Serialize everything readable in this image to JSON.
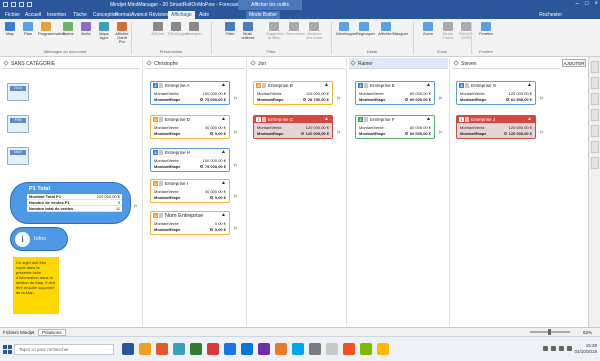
{
  "titlebar": {
    "title": "Mindjet MindManager - 20 SmartRollOnMoPow - Forecast",
    "context": "Afficher les outils"
  },
  "menu": {
    "tabs": [
      "Fichier",
      "Accueil",
      "Insertion",
      "Tâche",
      "Conception",
      "Format",
      "Avancé",
      "Révision",
      "Affichage",
      "Aide"
    ],
    "active_index": 8,
    "context_tab": "Mode Boitier",
    "user": "Rochester"
  },
  "ribbon": {
    "buttons": [
      {
        "label": "Map",
        "color": "#3a7bd5"
      },
      {
        "label": "Plan",
        "color": "#5aa0e8"
      },
      {
        "label": "Programmation",
        "color": "#e8a23a"
      },
      {
        "label": "Scène",
        "color": "#6fb36b"
      },
      {
        "label": "Boîte",
        "color": "#8c6bc4"
      },
      {
        "label": "Maps Agro",
        "color": "#3aa0b8"
      },
      {
        "label": "Afficher Gantt Pro",
        "color": "#d46f3a"
      },
      {
        "label": "Afficher",
        "color": "#888888"
      },
      {
        "label": "Développer",
        "color": "#888888"
      },
      {
        "label": "Masquer",
        "color": "#888888"
      },
      {
        "label": "Filtre",
        "color": "#4a7ac0"
      },
      {
        "label": "Multi-critères",
        "color": "#4a7ac0"
      },
      {
        "label": "Supprimer le filtre",
        "color": "#aaaaaa"
      },
      {
        "label": "Renommer",
        "color": "#aaaaaa"
      },
      {
        "label": "Gestion des vues",
        "color": "#aaaaaa"
      },
      {
        "label": "Développer",
        "color": "#5aa0e8"
      },
      {
        "label": "Regrouper",
        "color": "#5aa0e8"
      },
      {
        "label": "Afficher/Masquer",
        "color": "#5aa0e8"
      },
      {
        "label": "Zoom",
        "color": "#5aa0e8"
      },
      {
        "label": "Mode Focus",
        "color": "#aaaaaa"
      },
      {
        "label": "Remplir 100%",
        "color": "#aaaaaa"
      },
      {
        "label": "Fenêtre",
        "color": "#5aa0e8"
      }
    ],
    "groups": [
      "Affichages du document",
      "Présentation",
      "Filtre",
      "Détail",
      "Zoom",
      "Fenêtre"
    ]
  },
  "lanes": [
    {
      "label": "SANS CATÉGORIE"
    },
    {
      "label": "Christophe"
    },
    {
      "label": "Jon"
    },
    {
      "label": "Rainer"
    },
    {
      "label": "Steven"
    }
  ],
  "add_button": "AJOUTER",
  "left": {
    "slots": [
      "2016",
      "FEB",
      "MAR"
    ],
    "total": {
      "title": "P1 Total",
      "rows": [
        {
          "k": "Montant Total P1",
          "v": "220 000,00 €"
        },
        {
          "k": "Nombre de ventes P1",
          "v": "3"
        },
        {
          "k": "Nombre total de ventes",
          "v": "11"
        }
      ]
    },
    "infos": "Infos",
    "note": "Ce sujet doit être copié dans la présente bulle d'information dans la section de Map. Il doit être ensuite supprimé de la Map."
  },
  "cards": [
    {
      "lane": 1,
      "n": "2",
      "color": "blue",
      "name": "Entreprise A",
      "mv": "100 000,00 €",
      "me": "75 000,00 €"
    },
    {
      "lane": 1,
      "n": "3",
      "color": "orange",
      "name": "Entreprise D",
      "mv": "40 000,00 €",
      "me": "0,00 €"
    },
    {
      "lane": 1,
      "n": "2",
      "color": "blue",
      "name": "Entreprise H",
      "mv": "100 000,00 €",
      "me": "75 000,00 €"
    },
    {
      "lane": 1,
      "n": "4",
      "color": "orange",
      "name": "Entreprise I",
      "mv": "40 000,00 €",
      "me": "0,00 €"
    },
    {
      "lane": 1,
      "n": "4",
      "color": "orange",
      "name": "Nom Entreprise",
      "mv": "0,00 €",
      "me": "0,00 €",
      "big": true
    },
    {
      "lane": 2,
      "n": "3",
      "color": "orange",
      "name": "Entreprise B",
      "mv": "115 000,00 €",
      "me": "28 750,00 €"
    },
    {
      "lane": 2,
      "n": "1",
      "color": "red",
      "name": "Entreprise C",
      "mv": "120 000,00 €",
      "me": "120 000,00 €"
    },
    {
      "lane": 3,
      "n": "2",
      "color": "blue",
      "name": "Entreprise E",
      "mv": "80 000,00 €",
      "me": "60 000,00 €"
    },
    {
      "lane": 3,
      "n": "2",
      "color": "green",
      "name": "Entreprise F",
      "mv": "80 000,00 €",
      "me": "60 000,00 €"
    },
    {
      "lane": 4,
      "n": "3",
      "color": "blue",
      "name": "Entreprise G",
      "mv": "125 000,00 €",
      "me": "62 500,00 €"
    },
    {
      "lane": 4,
      "n": "1",
      "color": "red",
      "name": "Entreprise J",
      "mv": "120 000,00 €",
      "me": "120 000,00 €"
    }
  ],
  "field_labels": {
    "mv": "MontantVente",
    "me": "MontantEtape"
  },
  "fx": "fx",
  "status": {
    "left": "Fichiers Mindjet",
    "tab": "Polaisons",
    "zoom": "62%"
  },
  "taskbar": {
    "search": "Taper ici pour rechercher",
    "time": "15:38",
    "date": "03/10/2018"
  },
  "taskbar_apps": [
    "#2b579a",
    "#f0a020",
    "#e05a2b",
    "#3aa0b8",
    "#2e7d32",
    "#d63b3b",
    "#1a73e8",
    "#0078d7",
    "#6f2da8",
    "#e87b2b",
    "#00a4ef",
    "#7a7a7a",
    "#c8c8c8",
    "#f25022",
    "#7fba00",
    "#ffb900"
  ]
}
